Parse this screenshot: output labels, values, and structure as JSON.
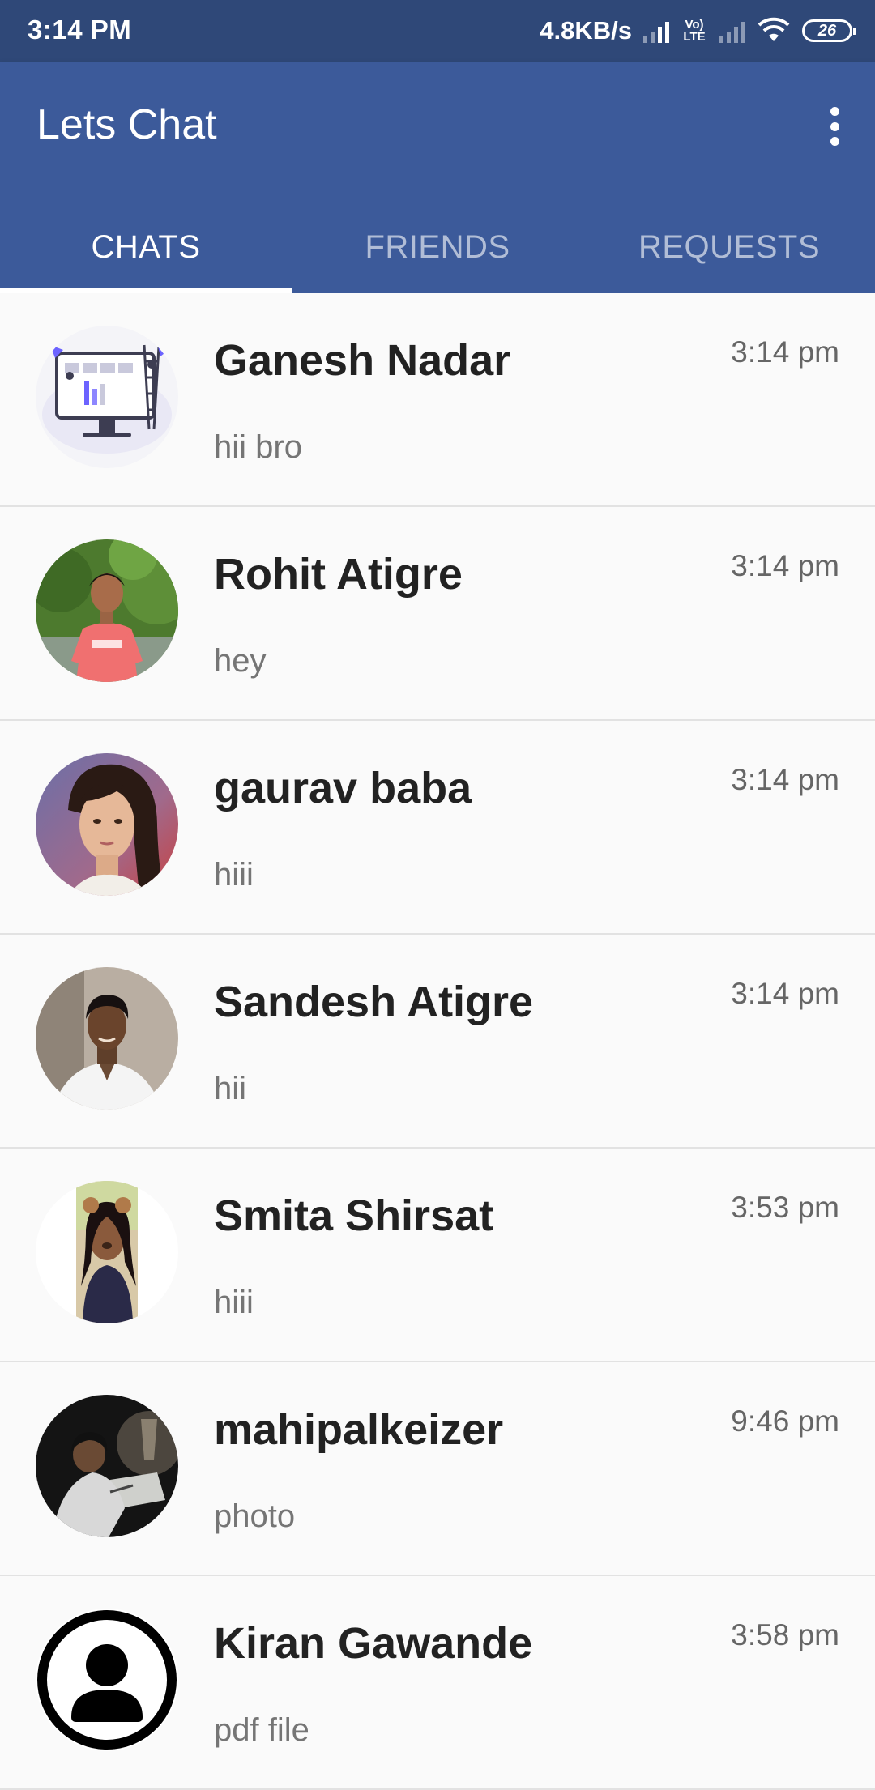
{
  "status_bar": {
    "time": "3:14 PM",
    "net_speed": "4.8KB/s",
    "volte": "Vo LTE",
    "battery": "26",
    "icons": [
      "signal-icon",
      "volte-icon",
      "signal-no-sim-icon",
      "wifi-icon",
      "battery-icon"
    ]
  },
  "app_bar": {
    "title": "Lets Chat",
    "menu_icon": "more-vert-icon",
    "color": "#3c5a9a"
  },
  "tabs": [
    {
      "label": "CHATS",
      "active": true
    },
    {
      "label": "FRIENDS",
      "active": false
    },
    {
      "label": "REQUESTS",
      "active": false
    }
  ],
  "chats": [
    {
      "name": "Ganesh Nadar",
      "message": "hii bro",
      "time": "3:14 pm",
      "avatar": "illustration-avatar"
    },
    {
      "name": "Rohit Atigre",
      "message": "hey",
      "time": "3:14 pm",
      "avatar": "photo-avatar"
    },
    {
      "name": "gaurav baba",
      "message": "hiii",
      "time": "3:14 pm",
      "avatar": "photo-avatar"
    },
    {
      "name": "Sandesh Atigre",
      "message": "hii",
      "time": "3:14 pm",
      "avatar": "photo-avatar"
    },
    {
      "name": "Smita Shirsat",
      "message": "hiii",
      "time": "3:53 pm",
      "avatar": "photo-avatar"
    },
    {
      "name": "mahipalkeizer",
      "message": "photo",
      "time": "9:46 pm",
      "avatar": "photo-avatar"
    },
    {
      "name": "Kiran Gawande",
      "message": "pdf file",
      "time": "3:58 pm",
      "avatar": "default-user-avatar"
    }
  ]
}
